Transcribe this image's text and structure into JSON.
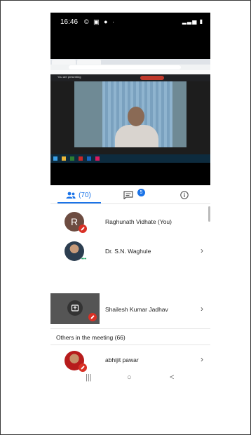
{
  "status_bar": {
    "time": "16:46",
    "icons": "© ▣ ● ·"
  },
  "meet_bar": {
    "presenting_text": "You are presenting"
  },
  "tabs": {
    "people_count": "(70)",
    "chat_badge": "5"
  },
  "participants": [
    {
      "initial": "R",
      "name": "Raghunath Vidhate (You)",
      "muted": true
    },
    {
      "name": "Dr. S.N. Waghule",
      "muted": false,
      "more": "•••"
    },
    {
      "name": "Shailesh Kumar Jadhav",
      "muted": true
    }
  ],
  "others_section": {
    "title": "Others in the meeting (66)"
  },
  "others": [
    {
      "name": "abhijit pawar",
      "muted": true
    }
  ],
  "colors": {
    "accent": "#1a73e8",
    "muted_red": "#d93025",
    "avatar_r": "#6d4c41"
  },
  "nav": {
    "recents": "|||",
    "home": "○",
    "back": "<"
  }
}
